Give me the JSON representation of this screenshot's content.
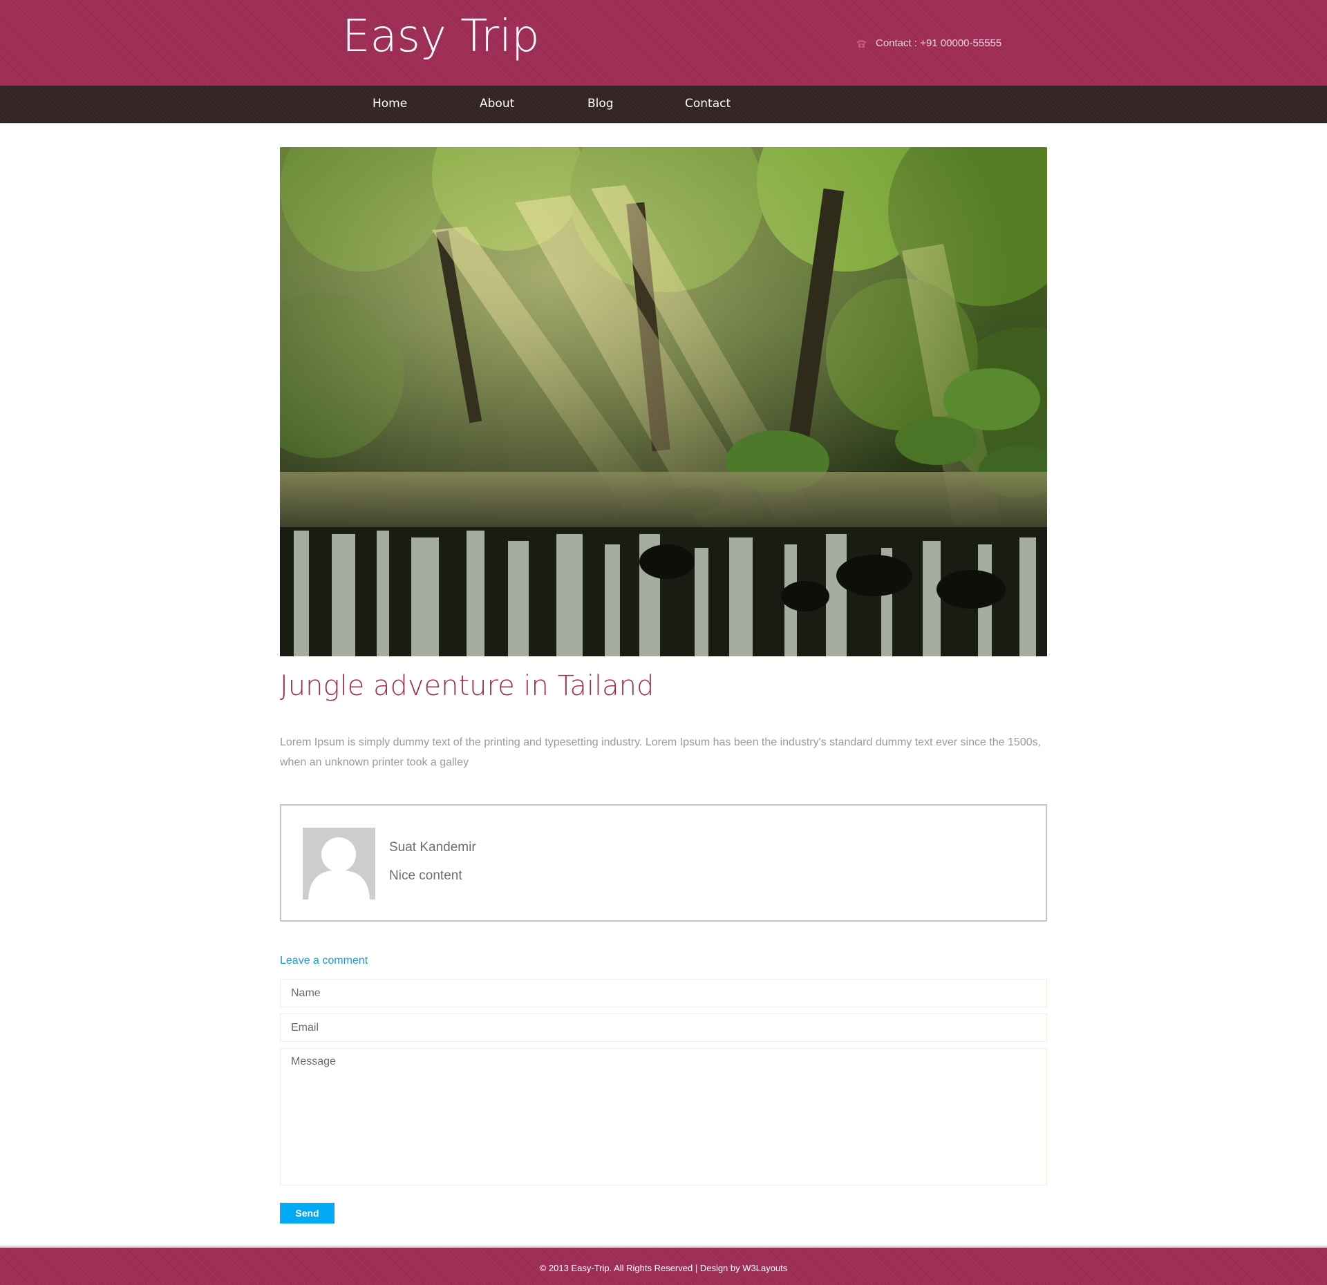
{
  "header": {
    "logo": "Easy Trip",
    "contact": "Contact : +91 00000-55555",
    "contact_icon": "phone-icon"
  },
  "nav": {
    "items": [
      {
        "label": "Home"
      },
      {
        "label": "About"
      },
      {
        "label": "Blog"
      },
      {
        "label": "Contact"
      }
    ]
  },
  "post": {
    "image_icon": "jungle-waterfall-photo",
    "title": "Jungle adventure in Tailand",
    "body": "Lorem Ipsum is simply dummy text of the printing and typesetting industry. Lorem Ipsum has been the industry's standard dummy text ever since the 1500s, when an unknown printer took a galley"
  },
  "comment": {
    "avatar_icon": "default-avatar-icon",
    "author": "Suat Kandemir",
    "text": "Nice content"
  },
  "form": {
    "heading": "Leave a comment",
    "name_placeholder": "Name",
    "email_placeholder": "Email",
    "message_placeholder": "Message",
    "send_label": "Send"
  },
  "footer": {
    "text": "© 2013 Easy-Trip. All Rights Reserved | Design by W3Layouts"
  },
  "colors": {
    "brand": "#9e2d55",
    "nav_bg": "#352525",
    "link": "#1b9ad6",
    "button": "#02a9f4"
  }
}
